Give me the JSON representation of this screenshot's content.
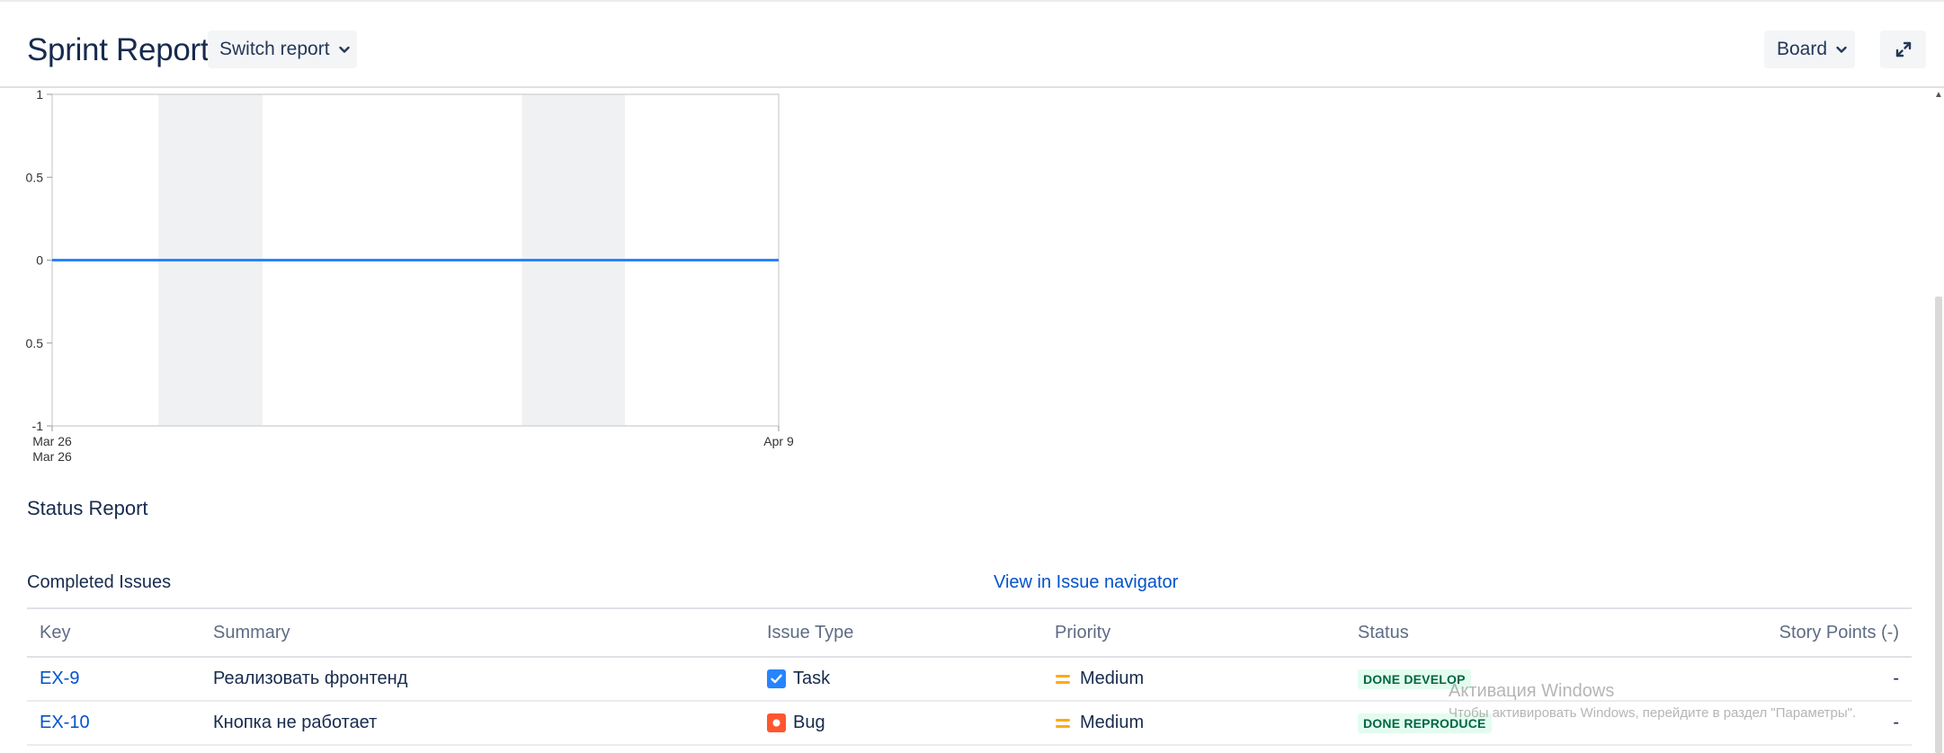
{
  "header": {
    "title": "Sprint Report",
    "switch_label": "Switch report",
    "board_label": "Board"
  },
  "chart_data": {
    "type": "line",
    "x": [
      "Mar 26",
      "Apr 9"
    ],
    "series": [
      {
        "values": [
          0,
          0
        ],
        "color": "#2684ff"
      }
    ],
    "ylim": [
      -1,
      1
    ],
    "y_ticks": [
      "1",
      "0.5",
      "0",
      "0.5",
      "-1"
    ],
    "x_ticks": [
      {
        "label": "Mar 26",
        "sublabel": "Mar 26",
        "pos": 0
      },
      {
        "label": "Apr 9",
        "sublabel": "",
        "pos": 1
      }
    ],
    "non_working_bands": [
      {
        "start": 0.1463,
        "end": 0.2896
      },
      {
        "start": 0.6467,
        "end": 0.7884
      }
    ],
    "grid": false
  },
  "status_report": {
    "title": "Status Report"
  },
  "completed": {
    "title": "Completed Issues",
    "navigator_link": "View in Issue navigator",
    "columns": [
      "Key",
      "Summary",
      "Issue Type",
      "Priority",
      "Status",
      "Story Points (-)"
    ],
    "rows": [
      {
        "key": "EX-9",
        "summary": "Реализовать фронтенд",
        "type": "Task",
        "type_icon": "task-icon",
        "type_color": "#2684ff",
        "priority": "Medium",
        "priority_color": "#ffab00",
        "status": "DONE DEVELOP",
        "points": "-"
      },
      {
        "key": "EX-10",
        "summary": "Кнопка не работает",
        "type": "Bug",
        "type_icon": "bug-icon",
        "type_color": "#ff5630",
        "priority": "Medium",
        "priority_color": "#ffab00",
        "status": "DONE REPRODUCE",
        "points": "-"
      }
    ]
  },
  "watermark": {
    "title": "Активация Windows",
    "subtitle": "Чтобы активировать Windows, перейдите в раздел \"Параметры\"."
  }
}
